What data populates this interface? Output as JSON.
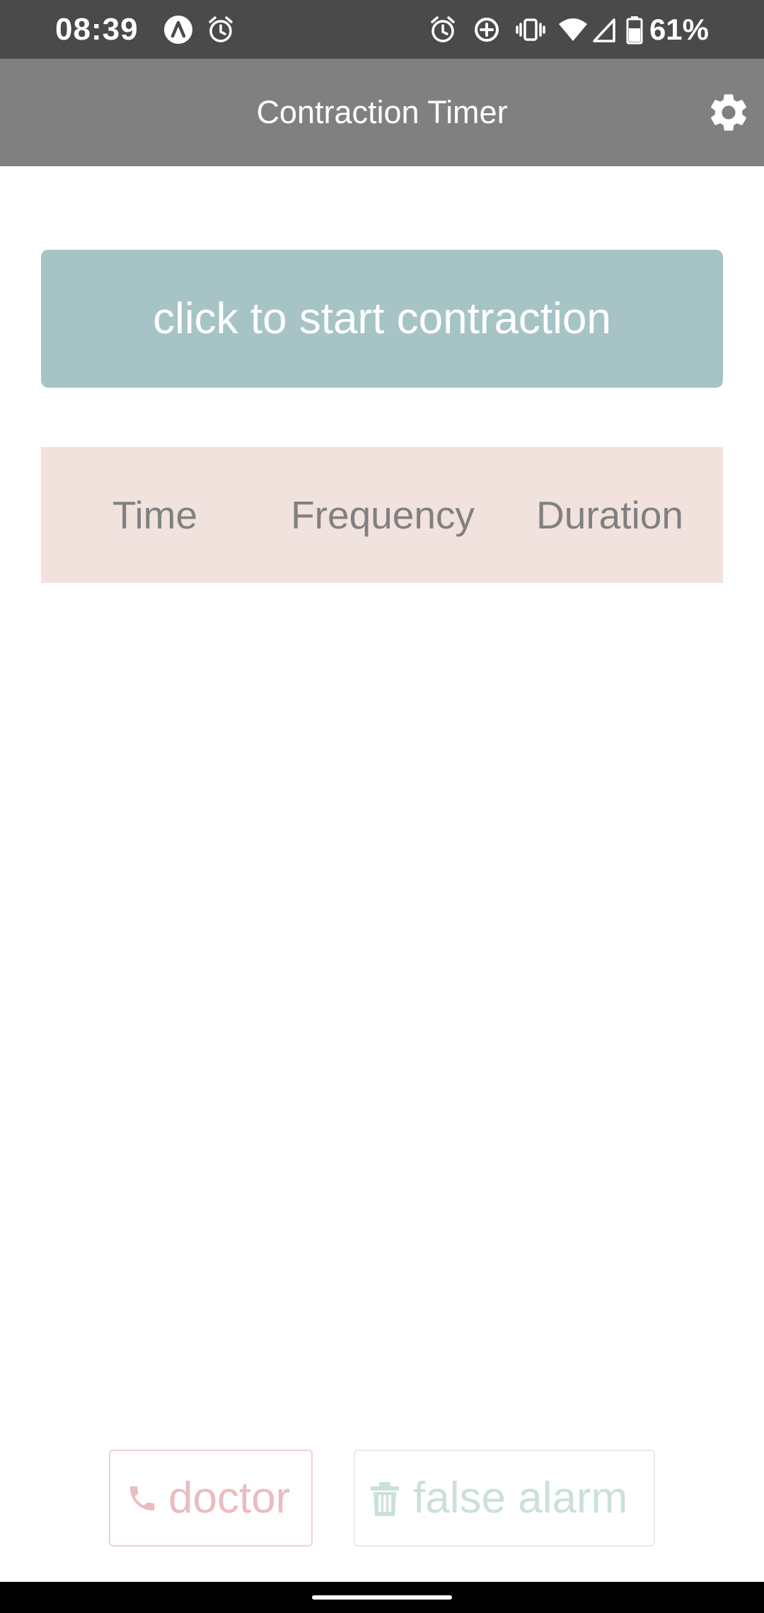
{
  "status_bar": {
    "time": "08:39",
    "battery_percent": "61%",
    "left_icons": [
      "app-notification-icon",
      "alarm-clock-icon"
    ],
    "right_icons": [
      "alarm-clock-icon",
      "data-saver-icon",
      "vibrate-icon",
      "wifi-icon",
      "cell-signal-icon",
      "battery-icon"
    ]
  },
  "app_bar": {
    "title": "Contraction Timer",
    "settings_icon": "gear-icon"
  },
  "main": {
    "start_button_label": "click to start contraction",
    "table": {
      "columns": [
        "Time",
        "Frequency",
        "Duration"
      ],
      "rows": []
    }
  },
  "footer": {
    "doctor_label": "doctor",
    "doctor_icon": "phone-icon",
    "false_alarm_label": "false alarm",
    "false_alarm_icon": "trash-icon"
  },
  "colors": {
    "status_bar": "#4a4a4a",
    "app_bar": "#808080",
    "start_button": "#a6c4c6",
    "table_header": "#f1e2dd",
    "doctor": "#ebbcbf",
    "false_alarm": "#cbe0dc"
  }
}
